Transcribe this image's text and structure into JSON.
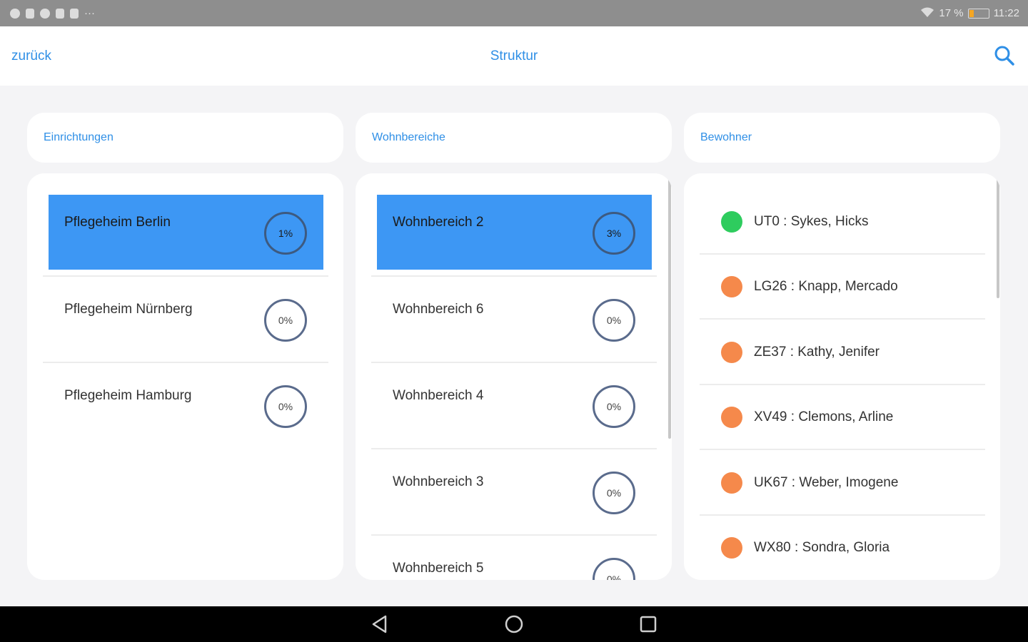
{
  "statusbar": {
    "battery_text": "17 %",
    "time": "11:22"
  },
  "appbar": {
    "back_label": "zurück",
    "title": "Struktur"
  },
  "columns": {
    "einrichtungen": {
      "header": "Einrichtungen",
      "items": [
        {
          "label": "Pflegeheim Berlin",
          "percent": "1%",
          "selected": true
        },
        {
          "label": "Pflegeheim Nürnberg",
          "percent": "0%",
          "selected": false
        },
        {
          "label": "Pflegeheim Hamburg",
          "percent": "0%",
          "selected": false
        }
      ]
    },
    "wohnbereiche": {
      "header": "Wohnbereiche",
      "items": [
        {
          "label": "Wohnbereich 2",
          "percent": "3%",
          "selected": true
        },
        {
          "label": "Wohnbereich 6",
          "percent": "0%",
          "selected": false
        },
        {
          "label": "Wohnbereich 4",
          "percent": "0%",
          "selected": false
        },
        {
          "label": "Wohnbereich 3",
          "percent": "0%",
          "selected": false
        },
        {
          "label": "Wohnbereich 5",
          "percent": "0%",
          "selected": false
        }
      ]
    },
    "bewohner": {
      "header": "Bewohner",
      "items": [
        {
          "label": "UT0 : Sykes, Hicks",
          "status_color": "#2ecc5e"
        },
        {
          "label": "LG26 : Knapp, Mercado",
          "status_color": "#f5894b"
        },
        {
          "label": "ZE37 : Kathy, Jenifer",
          "status_color": "#f5894b"
        },
        {
          "label": "XV49 : Clemons, Arline",
          "status_color": "#f5894b"
        },
        {
          "label": "UK67 : Weber, Imogene",
          "status_color": "#f5894b"
        },
        {
          "label": "WX80 : Sondra, Gloria",
          "status_color": "#f5894b"
        }
      ]
    }
  },
  "icons": {
    "search": "search-icon",
    "nav_back": "triangle-back-icon",
    "nav_home": "circle-home-icon",
    "nav_recents": "square-recents-icon"
  },
  "colors": {
    "accent": "#2f8fe6",
    "selected_bg": "#3d97f4"
  }
}
